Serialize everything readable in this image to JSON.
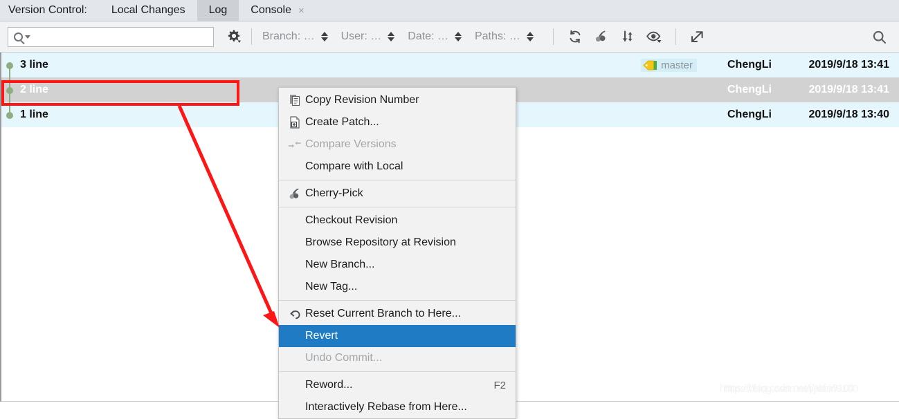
{
  "window": {
    "tool_label": "Version Control:",
    "tabs": [
      {
        "label": "Local Changes",
        "active": false,
        "closable": false
      },
      {
        "label": "Log",
        "active": true,
        "closable": false
      },
      {
        "label": "Console",
        "active": false,
        "closable": true
      }
    ],
    "close_glyph": "×"
  },
  "toolbar": {
    "search_placeholder": "",
    "search_value": "",
    "search_icon": "search-icon",
    "settings_icon": "gear-icon",
    "filters": [
      {
        "label": "Branch: …",
        "name": "branch"
      },
      {
        "label": "User: …",
        "name": "user"
      },
      {
        "label": "Date: …",
        "name": "date"
      },
      {
        "label": "Paths: …",
        "name": "paths"
      }
    ],
    "actions": [
      {
        "name": "refresh-icon",
        "title": "Refresh"
      },
      {
        "name": "cherry-pick-icon",
        "title": "Cherry-Pick"
      },
      {
        "name": "sort-icon",
        "title": "Intellisort"
      },
      {
        "name": "eye-icon",
        "title": "Show details"
      },
      {
        "name": "open-external-icon",
        "title": "Open in new window"
      }
    ],
    "right_search_icon": "search-icon"
  },
  "commits": {
    "columns": [
      "subject",
      "branch",
      "author",
      "date"
    ],
    "rows": [
      {
        "subject": "3 line",
        "branch": "master",
        "author": "ChengLi",
        "date": "2019/9/18 13:41",
        "selected": false,
        "has_branch_tag": true
      },
      {
        "subject": "2 line",
        "branch": "",
        "author": "ChengLi",
        "date": "2019/9/18 13:41",
        "selected": true,
        "has_branch_tag": false
      },
      {
        "subject": "1 line",
        "branch": "",
        "author": "ChengLi",
        "date": "2019/9/18 13:40",
        "selected": false,
        "has_branch_tag": false
      }
    ]
  },
  "context_menu": {
    "items": [
      {
        "label": "Copy Revision Number",
        "icon": "copy-icon",
        "state": "normal",
        "shortcut": ""
      },
      {
        "label": "Create Patch...",
        "icon": "patch-icon",
        "state": "normal",
        "shortcut": ""
      },
      {
        "label": "Compare Versions",
        "icon": "compare-icon",
        "state": "disabled",
        "shortcut": ""
      },
      {
        "label": "Compare with Local",
        "icon": "",
        "state": "normal",
        "shortcut": ""
      },
      {
        "separator": true
      },
      {
        "label": "Cherry-Pick",
        "icon": "cherry-icon",
        "state": "normal",
        "shortcut": ""
      },
      {
        "separator": true
      },
      {
        "label": "Checkout Revision",
        "icon": "",
        "state": "normal",
        "shortcut": ""
      },
      {
        "label": "Browse Repository at Revision",
        "icon": "",
        "state": "normal",
        "shortcut": ""
      },
      {
        "label": "New Branch...",
        "icon": "",
        "state": "normal",
        "shortcut": ""
      },
      {
        "label": "New Tag...",
        "icon": "",
        "state": "normal",
        "shortcut": ""
      },
      {
        "separator": true
      },
      {
        "label": "Reset Current Branch to Here...",
        "icon": "reset-icon",
        "state": "normal",
        "shortcut": ""
      },
      {
        "label": "Revert",
        "icon": "",
        "state": "selected",
        "shortcut": ""
      },
      {
        "label": "Undo Commit...",
        "icon": "",
        "state": "disabled",
        "shortcut": ""
      },
      {
        "separator": true
      },
      {
        "label": "Reword...",
        "icon": "",
        "state": "normal",
        "shortcut": "F2"
      },
      {
        "label": "Interactively Rebase from Here...",
        "icon": "",
        "state": "normal",
        "shortcut": ""
      }
    ]
  },
  "annotations": {
    "highlight_color": "#fe1616",
    "selection_color": "#1f7cc4",
    "graph_node_color": "#8fad80",
    "row_background": "#e5f6fd",
    "selected_row_background": "#d2d2d2",
    "box_target": "2 line",
    "arrow_target": "Revert"
  },
  "watermark": {
    "text": "https://blog.csdn.net/jiabin9100"
  }
}
